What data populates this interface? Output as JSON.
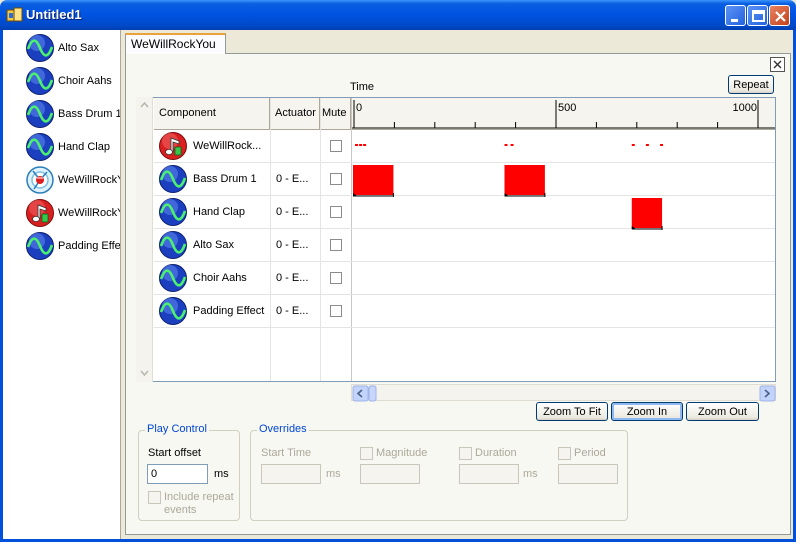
{
  "window": {
    "title": "Untitled1"
  },
  "left_list": [
    {
      "label": "Alto Sax",
      "icon": "wave-icon"
    },
    {
      "label": "Choir Aahs",
      "icon": "wave-icon"
    },
    {
      "label": "Bass Drum 1",
      "icon": "wave-icon"
    },
    {
      "label": "Hand Clap",
      "icon": "wave-icon"
    },
    {
      "label": "WeWillRockYou",
      "icon": "compound-effect-icon"
    },
    {
      "label": "WeWillRockYou",
      "icon": "music-note-icon"
    },
    {
      "label": "Padding Effect",
      "icon": "wave-icon"
    }
  ],
  "tab": {
    "label": "WeWillRockYou"
  },
  "toolbar": {
    "repeat_label": "Repeat"
  },
  "timeline": {
    "axis_label": "Time",
    "ticks": [
      "0",
      "500",
      "1000"
    ],
    "range": [
      0,
      1000
    ]
  },
  "grid": {
    "headers": {
      "component": "Component",
      "actuator": "Actuator",
      "mute": "Mute"
    },
    "rows": [
      {
        "name": "WeWillRock...",
        "actuator": "",
        "icon": "music-note-icon",
        "muted": false
      },
      {
        "name": "Bass Drum 1",
        "actuator": "0 - E...",
        "icon": "wave-icon",
        "muted": false
      },
      {
        "name": "Hand Clap",
        "actuator": "0 - E...",
        "icon": "wave-icon",
        "muted": false
      },
      {
        "name": "Alto Sax",
        "actuator": "0 - E...",
        "icon": "wave-icon",
        "muted": false
      },
      {
        "name": "Choir Aahs",
        "actuator": "0 - E...",
        "icon": "wave-icon",
        "muted": false
      },
      {
        "name": "Padding Effect",
        "actuator": "0 - E...",
        "icon": "wave-icon",
        "muted": false
      }
    ]
  },
  "events": {
    "bass_drum": [
      {
        "start": 0,
        "duration": 100
      },
      {
        "start": 375,
        "duration": 100
      }
    ],
    "hand_clap": [
      {
        "start": 690,
        "duration": 75
      }
    ],
    "summary_marks": [
      5,
      15,
      25,
      375,
      390,
      690,
      725,
      760
    ]
  },
  "zoom": {
    "fit_label": "Zoom To Fit",
    "in_label": "Zoom In",
    "out_label": "Zoom Out"
  },
  "play_control": {
    "title": "Play Control",
    "start_offset_label": "Start offset",
    "start_offset_value": "0",
    "unit": "ms",
    "include_repeat_label": "Include repeat events",
    "include_repeat_label_line1": "Include repeat",
    "include_repeat_label_line2": "events"
  },
  "overrides": {
    "title": "Overrides",
    "start_time_label": "Start Time",
    "start_time_unit": "ms",
    "magnitude_label": "Magnitude",
    "duration_label": "Duration",
    "duration_unit": "ms",
    "period_label": "Period"
  },
  "colors": {
    "event": "#ff0000",
    "titlebar": "#0054e3",
    "group_title": "#0046d5"
  }
}
